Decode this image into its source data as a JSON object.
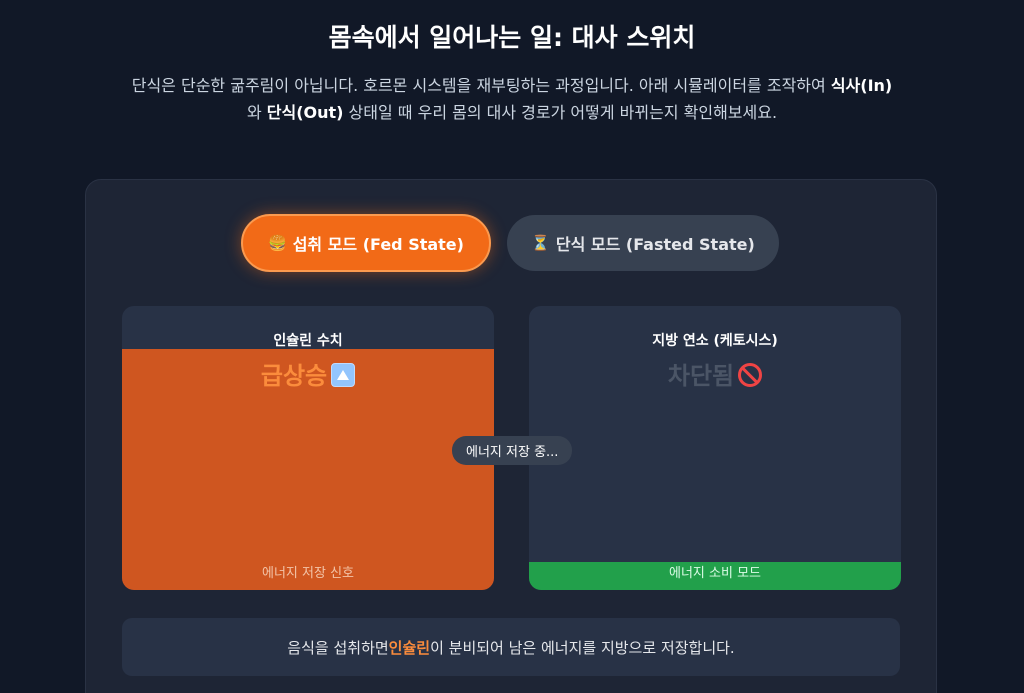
{
  "header": {
    "title": "몸속에서 일어나는 일: 대사 스위치",
    "intro_line1": "단식은 단순한 굶주림이 아닙니다. 호르몬 시스템을 재부팅하는 과정입니다. 아래 시뮬레이터를 조작하",
    "intro_line2_prefix": "여 ",
    "intro_bold_in": "식사(In)",
    "intro_mid": "와 ",
    "intro_bold_out": "단식(Out)",
    "intro_suffix": " 상태일 때 우리 몸의 대사 경로가 어떻게 바뀌는지 확인해보세요."
  },
  "modes": {
    "fed": {
      "icon": "🍔",
      "label": "섭취 모드 (Fed State)",
      "active": true
    },
    "fasted": {
      "icon": "⏳",
      "label": "단식 모드 (Fasted State)",
      "active": false
    }
  },
  "panels": {
    "insulin": {
      "title": "인슐린 수치",
      "status": "급상승",
      "status_icon": "up-arrow-icon",
      "footer": "에너지 저장 신호",
      "level": 0.85,
      "color": "#cf5620"
    },
    "fat_burn": {
      "title": "지방 연소 (케토시스)",
      "status": "차단됨",
      "status_icon": "prohibited-icon",
      "footer": "에너지 소비 모드",
      "level": 0.1,
      "color": "#22a04b"
    }
  },
  "flow_badge": "에너지 저장 중...",
  "note": {
    "prefix": "음식을 섭취하면 ",
    "highlight": "인슐린",
    "suffix": "이 분비되어 남은 에너지를 지방으로 저장합니다."
  },
  "colors": {
    "accent": "#f26a17",
    "background": "#111827",
    "card": "#1e2535"
  }
}
